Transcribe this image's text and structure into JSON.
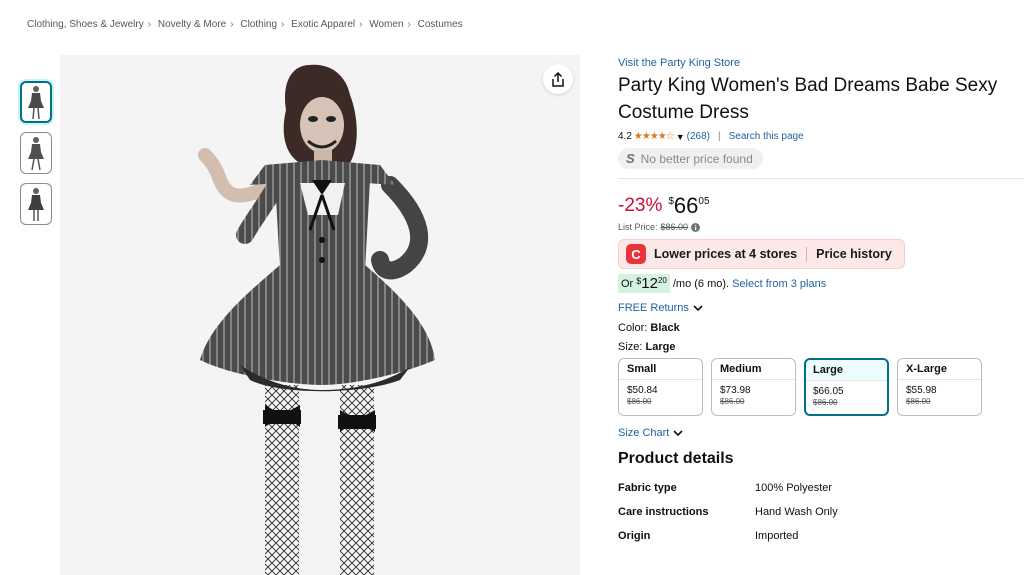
{
  "breadcrumb": [
    "Clothing, Shoes & Jewelry",
    "Novelty & More",
    "Clothing",
    "Exotic Apparel",
    "Women",
    "Costumes"
  ],
  "thumbnails": [
    {
      "icon": "costume-thumbnail-1"
    },
    {
      "icon": "costume-thumbnail-2"
    },
    {
      "icon": "costume-thumbnail-3"
    }
  ],
  "share_icon": "share-icon",
  "product": {
    "store_link": "Visit the Party King Store",
    "title": "Party King Women's Bad Dreams Babe Sexy Costume Dress",
    "rating_value": "4.2",
    "stars": "★★★★☆",
    "rating_count": "(268)",
    "search_link": "Search this page",
    "no_better_price_logo": "S",
    "no_better_price": "No better price found"
  },
  "price": {
    "discount": "-23%",
    "symbol": "$",
    "whole": "66",
    "fraction": "05",
    "list_price_label": "List Price:",
    "list_price": "$86.00"
  },
  "extension": {
    "icon_glyph": "C",
    "lower_prices": "Lower prices at 4 stores",
    "price_history": "Price history"
  },
  "installment": {
    "prefix": "Or",
    "symbol": "$",
    "whole": "12",
    "fraction": "20",
    "terms": "/mo (6 mo).",
    "plans_link": "Select from 3 plans"
  },
  "returns_label": "FREE Returns",
  "color": {
    "label": "Color:",
    "value": "Black"
  },
  "size": {
    "label": "Size:",
    "value": "Large"
  },
  "sizes": [
    {
      "name": "Small",
      "price": "$50.84",
      "list": "$86.00"
    },
    {
      "name": "Medium",
      "price": "$73.98",
      "list": "$86.00"
    },
    {
      "name": "Large",
      "price": "$66.05",
      "list": "$86.00"
    },
    {
      "name": "X-Large",
      "price": "$55.98",
      "list": "$86.00"
    }
  ],
  "size_chart": "Size Chart",
  "details": {
    "title": "Product details",
    "rows": [
      {
        "key": "Fabric type",
        "value": "100% Polyester"
      },
      {
        "key": "Care instructions",
        "value": "Hand Wash Only"
      },
      {
        "key": "Origin",
        "value": "Imported"
      }
    ]
  },
  "colors": {
    "link": "#2162a1",
    "discount": "#cc0c39",
    "stars": "#de7921",
    "selected_border": "#007185"
  }
}
